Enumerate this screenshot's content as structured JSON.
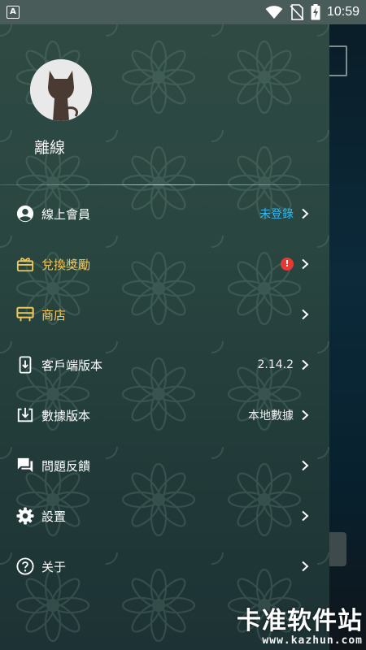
{
  "status_bar": {
    "app_indicator": "A",
    "time": "10:59"
  },
  "profile": {
    "username": "離線"
  },
  "menu": [
    {
      "label": "線上會員",
      "value": "未登錄",
      "icon": "account-circle-icon"
    },
    {
      "label": "兌換獎勵",
      "badge": "!",
      "icon": "gift-icon"
    },
    {
      "label": "商店",
      "icon": "store-icon"
    },
    {
      "label": "客戶端版本",
      "value": "2.14.2",
      "icon": "phone-download-icon"
    },
    {
      "label": "數據版本",
      "value": "本地數據",
      "icon": "data-download-icon"
    },
    {
      "label": "問題反饋",
      "icon": "feedback-icon"
    },
    {
      "label": "設置",
      "icon": "gear-icon"
    },
    {
      "label": "关于",
      "icon": "help-icon"
    }
  ],
  "watermark": {
    "title": "卡准软件站",
    "url": "www.kazhun.com"
  },
  "colors": {
    "accent_gold": "#f0c85a",
    "accent_blue": "#35b7ef",
    "badge_red": "#e53935",
    "drawer_top": "#2e4a43",
    "drawer_bottom": "#1d3234"
  }
}
